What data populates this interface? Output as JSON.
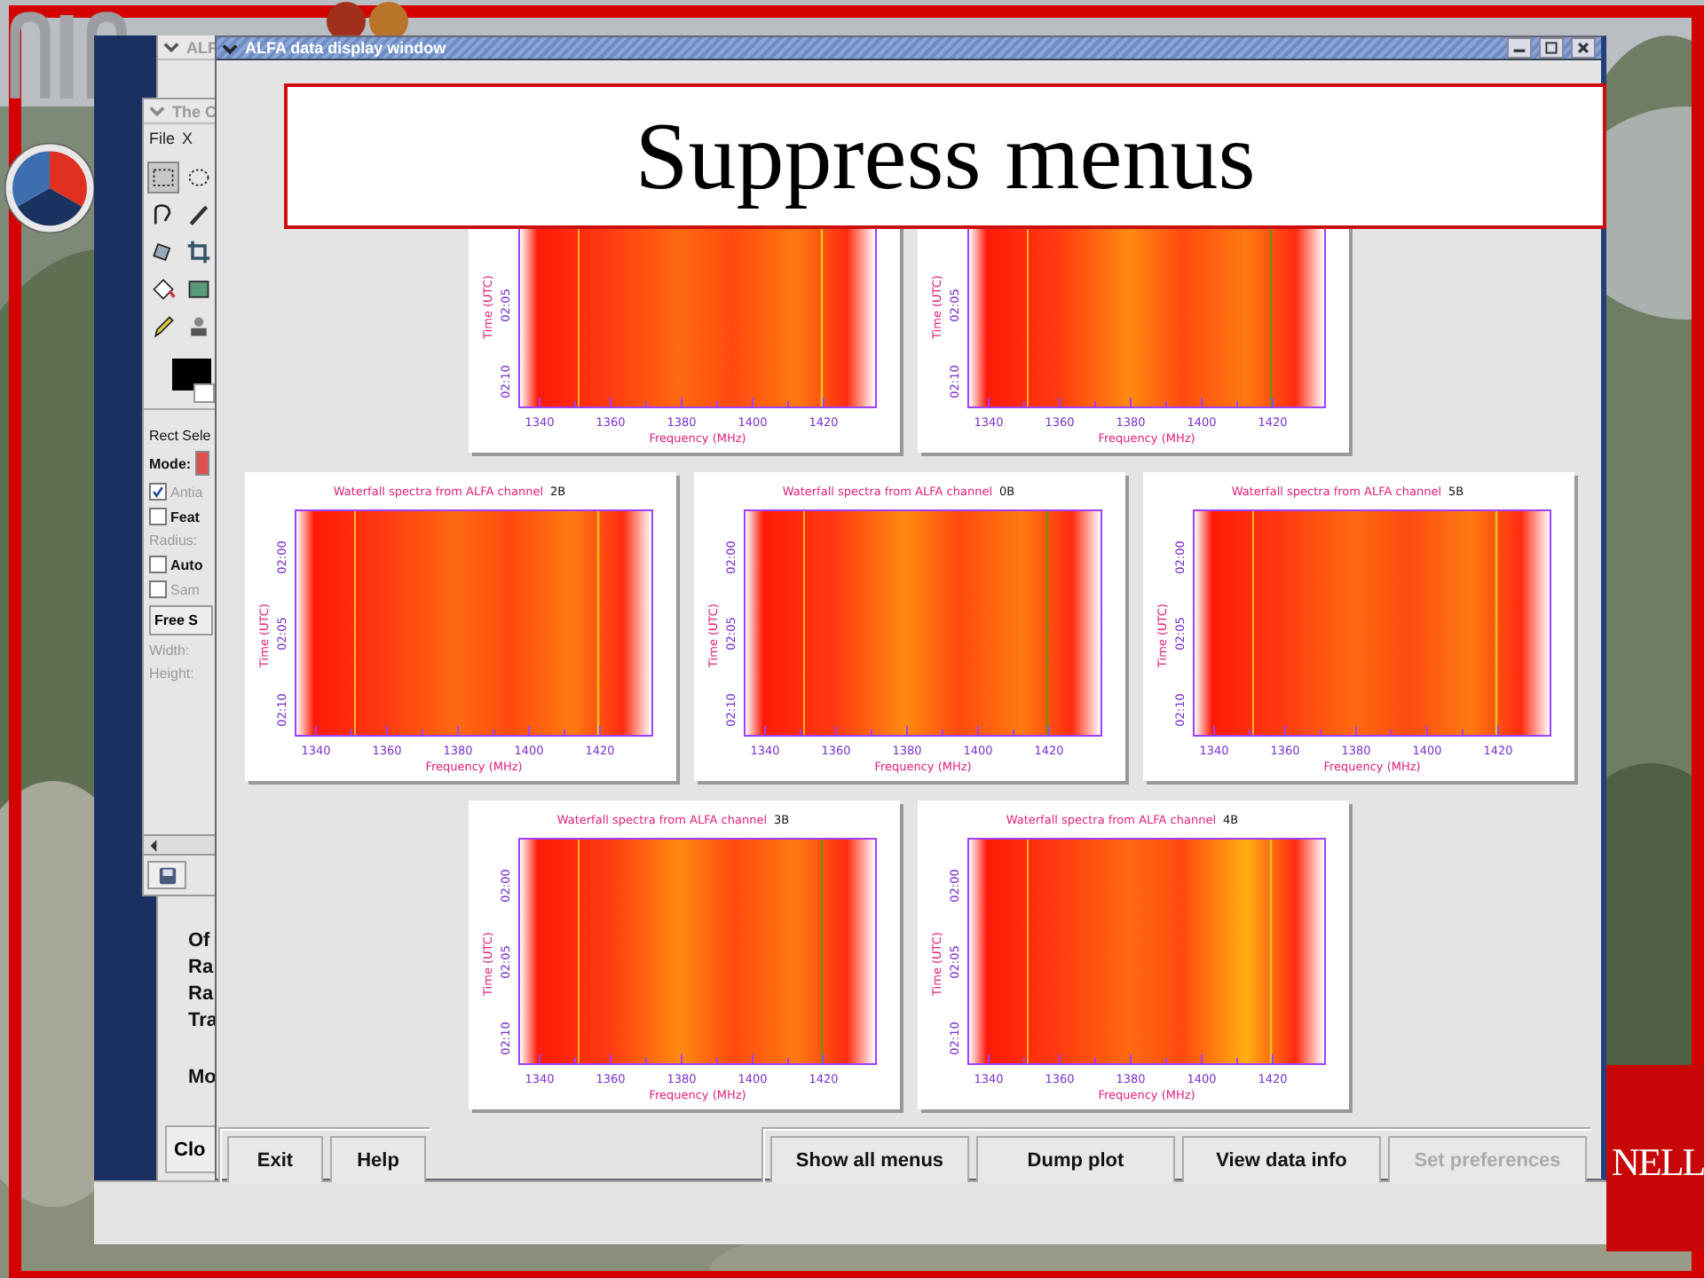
{
  "slide": {
    "title": "Suppress menus",
    "corner_text": "NELL"
  },
  "back_window": {
    "title": "ALF",
    "label_groups": [
      [
        "Of",
        "Ra",
        "Ra",
        "Tra"
      ],
      [
        "Mo"
      ]
    ],
    "button": "Clo"
  },
  "toolbox": {
    "title": "The C",
    "menus": [
      "File",
      "X"
    ],
    "tools": [
      {
        "kind": "rect-select",
        "selected": true
      },
      {
        "kind": "ellipse",
        "selected": false
      },
      {
        "kind": "lasso",
        "selected": false
      },
      {
        "kind": "eyedropper",
        "selected": false
      },
      {
        "kind": "transform",
        "selected": false
      },
      {
        "kind": "crop",
        "selected": false
      },
      {
        "kind": "bucket",
        "selected": false
      },
      {
        "kind": "gradient",
        "selected": false
      },
      {
        "kind": "pencil",
        "selected": false
      },
      {
        "kind": "stamp",
        "selected": false
      }
    ],
    "options_title": "Rect Sele",
    "mode_label": "Mode:",
    "options": [
      {
        "kind": "checkbox",
        "label": "Antia",
        "checked": true,
        "disabled": true
      },
      {
        "kind": "checkbox",
        "label": "Feat",
        "checked": false,
        "disabled": false
      },
      {
        "kind": "label",
        "label": "Radius:",
        "disabled": true
      },
      {
        "kind": "checkbox",
        "label": "Auto",
        "checked": false,
        "disabled": false
      },
      {
        "kind": "checkbox",
        "label": "Sam",
        "checked": false,
        "disabled": true
      },
      {
        "kind": "button",
        "label": "Free S"
      },
      {
        "kind": "label",
        "label": "Width:",
        "disabled": true
      },
      {
        "kind": "label",
        "label": "Height:",
        "disabled": true
      }
    ]
  },
  "main_window": {
    "title": "ALFA data display window",
    "plot_rows": [
      [
        {
          "xticks": [
            "1340",
            "1360",
            "1380",
            "1400",
            "1420"
          ],
          "yticks": [
            "02:05",
            "02:10"
          ],
          "xlabel": "Frequency  (MHz)",
          "ylabel": "Time  (UTC)"
        },
        {
          "xticks": [
            "1340",
            "1360",
            "1380",
            "1400",
            "1420"
          ],
          "yticks": [
            "02:05",
            "02:10"
          ],
          "xlabel": "Frequency  (MHz)",
          "ylabel": "Time  (UTC)"
        }
      ],
      [
        {
          "title": "Waterfall spectra from ALFA channel",
          "channel": "2B",
          "xticks": [
            "1340",
            "1360",
            "1380",
            "1400",
            "1420"
          ],
          "yticks": [
            "02:00",
            "02:05",
            "02:10"
          ],
          "xlabel": "Frequency  (MHz)",
          "ylabel": "Time  (UTC)"
        },
        {
          "title": "Waterfall spectra from ALFA channel",
          "channel": "0B",
          "xticks": [
            "1340",
            "1360",
            "1380",
            "1400",
            "1420"
          ],
          "yticks": [
            "02:00",
            "02:05",
            "02:10"
          ],
          "xlabel": "Frequency  (MHz)",
          "ylabel": "Time  (UTC)"
        },
        {
          "title": "Waterfall spectra from ALFA channel",
          "channel": "5B",
          "xticks": [
            "1340",
            "1360",
            "1380",
            "1400",
            "1420"
          ],
          "yticks": [
            "02:00",
            "02:05",
            "02:10"
          ],
          "xlabel": "Frequency  (MHz)",
          "ylabel": "Time  (UTC)"
        }
      ],
      [
        {
          "title": "Waterfall spectra from ALFA channel",
          "channel": "3B",
          "xticks": [
            "1340",
            "1360",
            "1380",
            "1400",
            "1420"
          ],
          "yticks": [
            "02:00",
            "02:05",
            "02:10"
          ],
          "xlabel": "Frequency  (MHz)",
          "ylabel": "Time  (UTC)"
        },
        {
          "title": "Waterfall spectra from ALFA channel",
          "channel": "4B",
          "xticks": [
            "1340",
            "1360",
            "1380",
            "1400",
            "1420"
          ],
          "yticks": [
            "02:00",
            "02:05",
            "02:10"
          ],
          "xlabel": "Frequency  (MHz)",
          "ylabel": "Time  (UTC)"
        }
      ]
    ],
    "left_buttons": [
      {
        "label": "Exit",
        "disabled": false
      },
      {
        "label": "Help",
        "disabled": false
      }
    ],
    "right_buttons": [
      {
        "label": "Show all menus",
        "disabled": false
      },
      {
        "label": "Dump plot",
        "disabled": false
      },
      {
        "label": "View data info",
        "disabled": false
      },
      {
        "label": "Set preferences",
        "disabled": true
      }
    ]
  }
}
